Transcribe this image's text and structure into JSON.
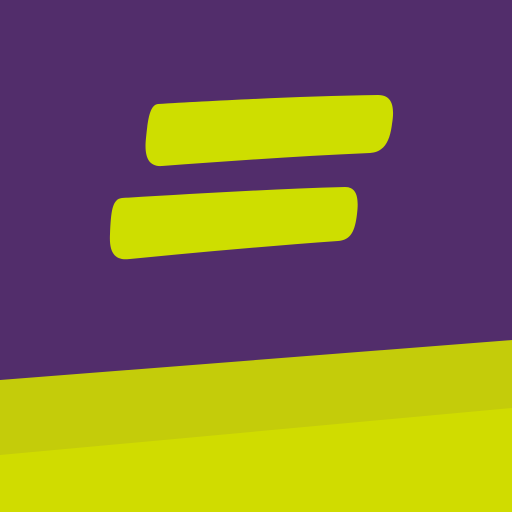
{
  "icon": {
    "name": "app-icon",
    "symbol": "two-stroke-logo-icon",
    "colors": {
      "background": "#522d6b",
      "stroke": "#cede00",
      "band_dark": "#c4cc0a",
      "band_light": "#d0dc00"
    }
  }
}
